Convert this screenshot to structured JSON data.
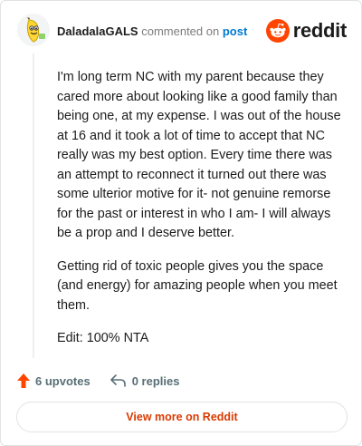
{
  "header": {
    "author": "DaladalaGALS",
    "action_text": "commented on",
    "post_link": "post",
    "brand_wordmark": "reddit"
  },
  "comment": {
    "paragraphs": [
      "I'm long term NC with my parent because they cared more about looking like a good family than being one, at my expense. I was out of the house at 16 and it took a lot of time to accept that NC really was my best option. Every time there was an attempt to reconnect it turned out there was some ulterior motive for it- not genuine remorse for the past or interest in who I am- I will always be a prop and I deserve better.",
      "Getting rid of toxic people gives you the space (and energy) for amazing people when you meet them.",
      "Edit: 100% NTA"
    ]
  },
  "actions": {
    "upvotes": "6 upvotes",
    "replies": "0 replies"
  },
  "footer": {
    "view_more": "View more on Reddit"
  },
  "colors": {
    "upvote": "#ff4500",
    "brand": "#ff4500",
    "link": "#0079d3",
    "view_more": "#d93a00"
  },
  "icons": {
    "avatar": "banana-avatar",
    "brand": "reddit-snoo-icon",
    "upvote": "upvote-arrow-icon",
    "reply": "reply-arrow-icon"
  }
}
